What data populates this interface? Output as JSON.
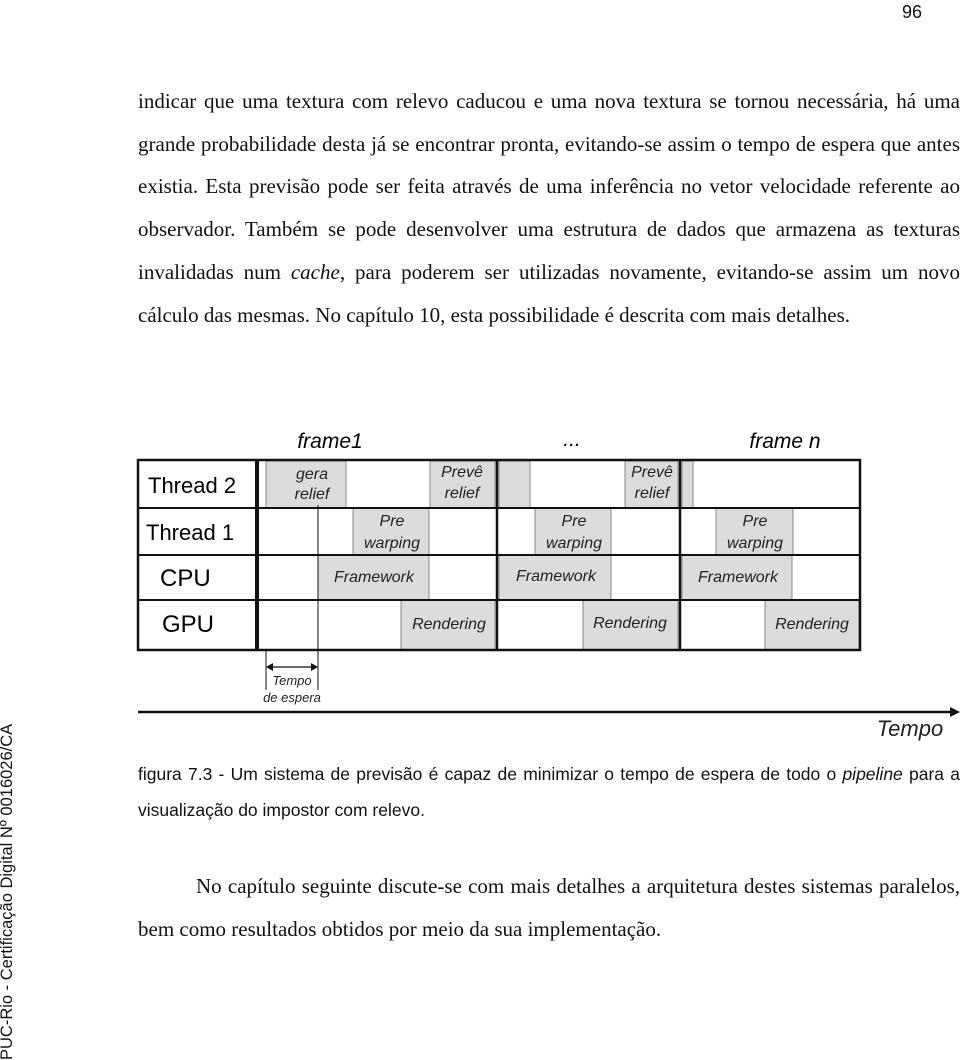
{
  "page_number": "96",
  "side_watermark": "PUC-Rio - Certificação Digital Nº 0016026/CA",
  "paragraph1": {
    "pre": "indicar que uma textura com relevo caducou e uma nova textura se tornou necessária, há uma grande probabilidade desta já se encontrar pronta, evitando-se assim o tempo de espera que antes existia. Esta previsão pode ser feita através de uma inferência no vetor velocidade referente ao observador. Também se pode desenvolver uma estrutura de dados que armazena as texturas invalidadas num ",
    "italic": "cache",
    "post": ", para poderem ser utilizadas novamente, evitando-se assim um novo cálculo das mesmas. No capítulo 10, esta possibilidade é descrita com mais detalhes."
  },
  "figure": {
    "frame_labels": [
      "frame1",
      "...",
      "frame n"
    ],
    "rows": [
      "Thread 2",
      "Thread 1",
      "CPU",
      "GPU"
    ],
    "blocks": {
      "gera": [
        "gera",
        "relief"
      ],
      "preve": [
        "Prevê",
        "relief"
      ],
      "pre": [
        "Pre",
        "warping"
      ],
      "framework": "Framework",
      "rendering": "Rendering"
    },
    "wait_label": [
      "Tempo",
      "de espera"
    ],
    "axis_label": "Tempo",
    "block_color": "#dcdcdc"
  },
  "caption": {
    "pre": "figura 7.3  - Um sistema de previsão é capaz de minimizar o tempo de espera de todo o ",
    "italic": "pipeline",
    "post": " para a visualização do impostor com relevo."
  },
  "paragraph2": "No capítulo seguinte discute-se com mais detalhes a arquitetura destes sistemas paralelos, bem como resultados obtidos por meio da sua implementação."
}
